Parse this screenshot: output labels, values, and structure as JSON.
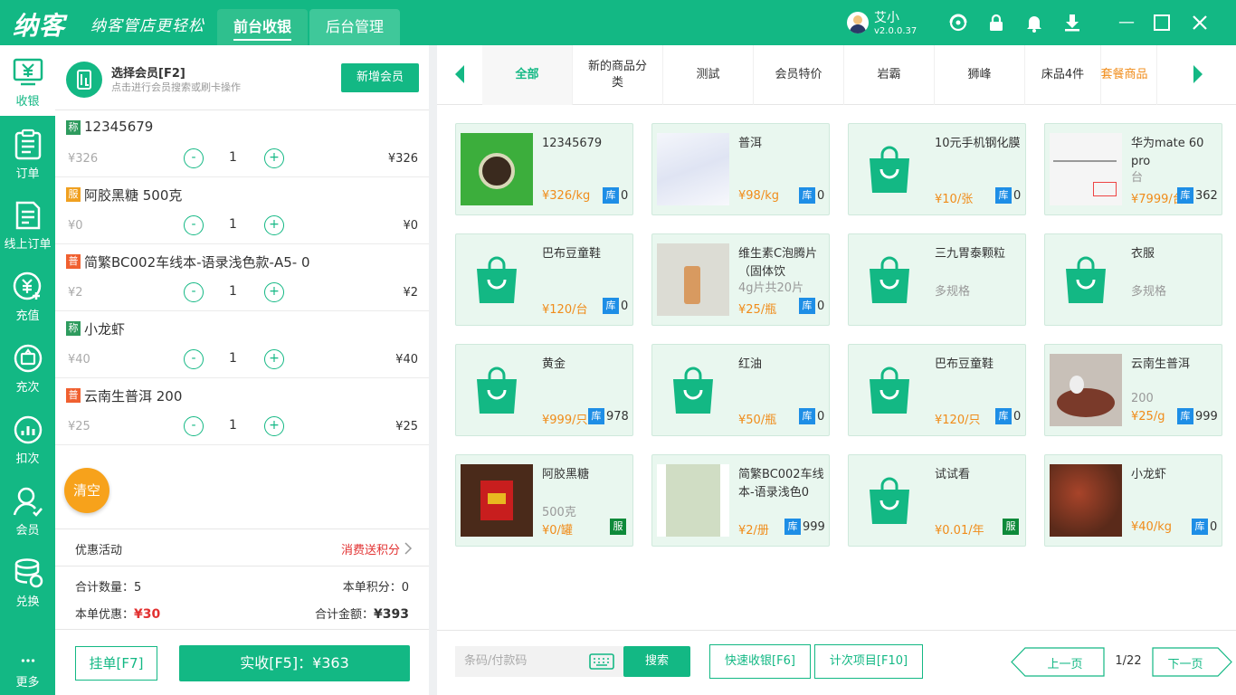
{
  "header": {
    "logo": "纳客",
    "slogan": "纳客管店更轻松",
    "tabs": [
      {
        "label": "前台收银"
      },
      {
        "label": "后台管理"
      }
    ],
    "user": {
      "name": "艾小",
      "version": "v2.0.0.37"
    }
  },
  "sidebar": {
    "items": [
      {
        "label": "收银",
        "icon": "cashier-icon"
      },
      {
        "label": "订单",
        "icon": "order-icon"
      },
      {
        "label": "线上订单",
        "icon": "online-order-icon"
      },
      {
        "label": "充值",
        "icon": "recharge-icon"
      },
      {
        "label": "充次",
        "icon": "recharge-times-icon"
      },
      {
        "label": "扣次",
        "icon": "deduct-icon"
      },
      {
        "label": "会员",
        "icon": "member-icon"
      },
      {
        "label": "兑换",
        "icon": "exchange-icon"
      },
      {
        "label": "更多",
        "icon": "more-icon"
      }
    ]
  },
  "member": {
    "title": "选择会员[F2]",
    "subtitle": "点击进行会员搜索或刷卡操作",
    "add_label": "新增会员"
  },
  "cart": {
    "items": [
      {
        "tag": "称",
        "tag_color": "#2e9b5e",
        "name": "12345679",
        "price": "¥326",
        "qty": "1",
        "total": "¥326"
      },
      {
        "tag": "服",
        "tag_color": "#f0a020",
        "name": "阿胶黑糖 500克",
        "price": "¥0",
        "qty": "1",
        "total": "¥0"
      },
      {
        "tag": "普",
        "tag_color": "#f06030",
        "name": "简繁BC002车线本-语录浅色款-A5- 0",
        "price": "¥2",
        "qty": "1",
        "total": "¥2"
      },
      {
        "tag": "称",
        "tag_color": "#2e9b5e",
        "name": "小龙虾",
        "price": "¥40",
        "qty": "1",
        "total": "¥40"
      },
      {
        "tag": "普",
        "tag_color": "#f06030",
        "name": "云南生普洱 200",
        "price": "¥25",
        "qty": "1",
        "total": "¥25"
      }
    ],
    "minus": "-",
    "plus": "+",
    "clear_label": "清空"
  },
  "promo": {
    "label": "优惠活动",
    "value": "消费送积分"
  },
  "summary": {
    "total_qty_label": "合计数量：",
    "total_qty": "5",
    "points_label": "本单积分：",
    "points": "0",
    "discount_label": "本单优惠：",
    "discount": "¥30",
    "total_amount_label": "合计金额：",
    "total_amount": "¥393"
  },
  "actions": {
    "hold_label": "挂单[F7]",
    "pay_label": "实收[F5]：¥363"
  },
  "categories": [
    {
      "label": "全部"
    },
    {
      "label": "新的商品分类"
    },
    {
      "label": "测試"
    },
    {
      "label": "会员特价"
    },
    {
      "label": "岩霸"
    },
    {
      "label": "狮峰"
    },
    {
      "label": "床品4件"
    },
    {
      "label": "套餐商品"
    }
  ],
  "products": [
    {
      "name": "12345679",
      "spec": "",
      "price": "¥326/kg",
      "badge": "库",
      "stock": "0",
      "thumb": "tea-photo"
    },
    {
      "name": "普洱",
      "spec": "",
      "price": "¥98/kg",
      "badge": "库",
      "stock": "0",
      "thumb": "wave-photo"
    },
    {
      "name": "10元手机钢化膜",
      "spec": "",
      "price": "¥10/张",
      "badge": "库",
      "stock": "0",
      "thumb": "bag"
    },
    {
      "name": "华为mate 60 pro",
      "spec": "台",
      "price": "¥7999/台",
      "badge": "库",
      "stock": "362",
      "thumb": "diagram-photo"
    },
    {
      "name": "巴布豆童鞋",
      "spec": "",
      "price": "¥120/台",
      "badge": "库",
      "stock": "0",
      "thumb": "bag"
    },
    {
      "name": "维生素C泡腾片（固体饮",
      "spec": "4g片共20片",
      "price": "¥25/瓶",
      "badge": "库",
      "stock": "0",
      "thumb": "hand-photo"
    },
    {
      "name": "三九胃泰颗粒",
      "spec": "多规格",
      "price": "",
      "badge": "",
      "stock": "",
      "thumb": "bag"
    },
    {
      "name": "衣服",
      "spec": "多规格",
      "price": "",
      "badge": "",
      "stock": "",
      "thumb": "bag"
    },
    {
      "name": "黄金",
      "spec": "",
      "price": "¥999/只",
      "badge": "库",
      "stock": "978",
      "thumb": "bag"
    },
    {
      "name": "红油",
      "spec": "",
      "price": "¥50/瓶",
      "badge": "库",
      "stock": "0",
      "thumb": "bag"
    },
    {
      "name": "巴布豆童鞋",
      "spec": "",
      "price": "¥120/只",
      "badge": "库",
      "stock": "0",
      "thumb": "bag"
    },
    {
      "name": "云南生普洱",
      "spec": "200",
      "price": "¥25/g",
      "badge": "库",
      "stock": "999",
      "thumb": "teaset-photo"
    },
    {
      "name": "阿胶黑糖",
      "spec": "500克",
      "price": "¥0/罐",
      "badge": "服",
      "stock": "",
      "thumb": "jar-photo"
    },
    {
      "name": "简繁BC002车线本-语录浅色0",
      "spec": "",
      "price": "¥2/册",
      "badge": "库",
      "stock": "999",
      "thumb": "book-photo"
    },
    {
      "name": "试试看",
      "spec": "",
      "price": "¥0.01/年",
      "badge": "服",
      "stock": "",
      "thumb": "bag"
    },
    {
      "name": "小龙虾",
      "spec": "",
      "price": "¥40/kg",
      "badge": "库",
      "stock": "0",
      "thumb": "crayfish-photo"
    }
  ],
  "bottom": {
    "search_placeholder": "条码/付款码",
    "search_label": "搜索",
    "quick_label": "快速收银[F6]",
    "count_label": "计次项目[F10]",
    "prev_label": "上一页",
    "page": "1/22",
    "next_label": "下一页"
  },
  "colors": {
    "brand": "#13b884",
    "price": "#f08c1a",
    "discount": "#e23131",
    "stock_badge": "#1e8ee6"
  }
}
